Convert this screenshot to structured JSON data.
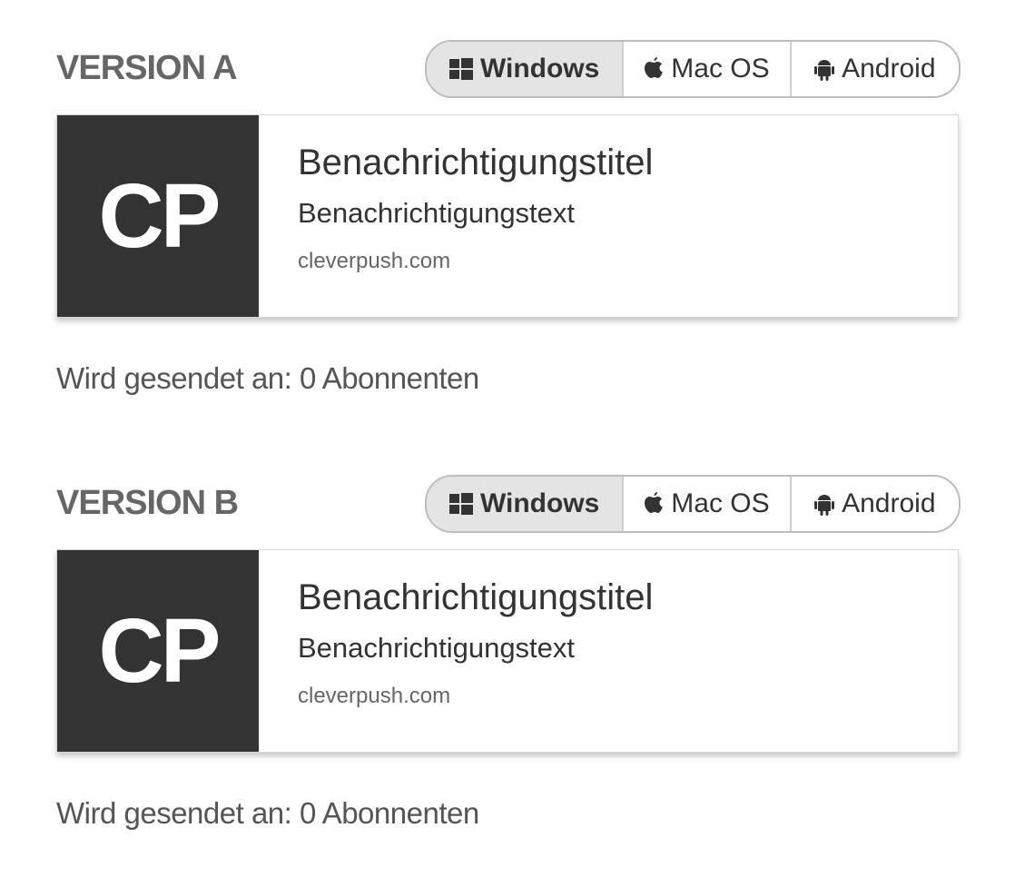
{
  "os_options": {
    "windows": "Windows",
    "macos": "Mac OS",
    "android": "Android"
  },
  "versions": [
    {
      "title": "VERSION A",
      "active_os": "Windows",
      "notification": {
        "icon_text": "CP",
        "title": "Benachrichtigungstitel",
        "text": "Benachrichtigungstext",
        "domain": "cleverpush.com"
      },
      "recipients": "Wird gesendet an: 0 Abonnenten"
    },
    {
      "title": "VERSION B",
      "active_os": "Windows",
      "notification": {
        "icon_text": "CP",
        "title": "Benachrichtigungstitel",
        "text": "Benachrichtigungstext",
        "domain": "cleverpush.com"
      },
      "recipients": "Wird gesendet an: 0 Abonnenten"
    }
  ],
  "icons": {
    "windows": "windows-icon",
    "macos": "apple-icon",
    "android": "android-icon"
  },
  "colors": {
    "icon_background": "#333333",
    "active_tab_background": "#e4e4e4",
    "text": "#333333",
    "muted_text": "#666666"
  }
}
